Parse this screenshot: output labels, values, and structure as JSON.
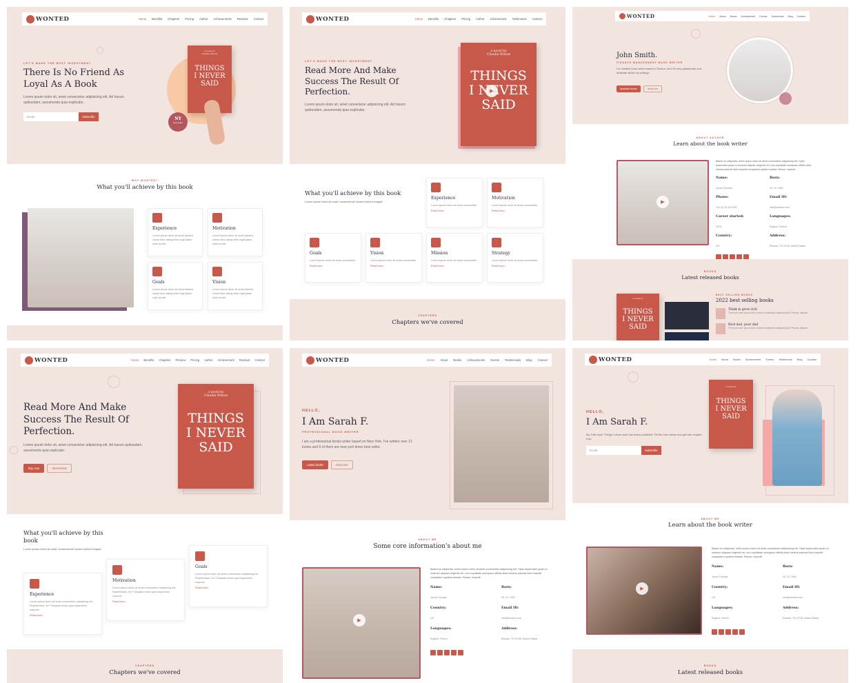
{
  "brand": "WONTED",
  "menus": {
    "m1": [
      "Home",
      "Benefits",
      "Chapters",
      "Pricing",
      "Author",
      "Achievements",
      "Reviews",
      "Contact"
    ],
    "m2": [
      "Home",
      "Benefits",
      "Chapters",
      "Pricing",
      "Author",
      "Achievement",
      "Testimonial",
      "Contact"
    ],
    "m3": [
      "Home",
      "About",
      "Books",
      "Achievement",
      "Events",
      "Testimonial",
      "Blog",
      "Contact"
    ],
    "m4": [
      "Home",
      "Benefits",
      "Chapters",
      "Preview",
      "Pricing",
      "Author",
      "Achievement",
      "Reviews",
      "Contact"
    ],
    "m5": [
      "Home",
      "About",
      "Books",
      "Achievements",
      "Events",
      "Testimonials",
      "Blog",
      "Contact"
    ],
    "m6": [
      "Home",
      "About",
      "Books",
      "Achievement",
      "Events",
      "Testimonial",
      "Blog",
      "Contact"
    ]
  },
  "p1": {
    "eyebrow": "LET'S MAKE THE BEST INVESTMENT",
    "title": "There Is No Friend As Loyal As A Book",
    "text": "Lorem ipsum dolor sit, amet consectetur adipisicing elit. Ad harum quibusdam, assumenda quia explicabo.",
    "email_ph": "Email",
    "subscribe": "Subscribe",
    "badge_top": "NY",
    "badge_bottom": "best seller",
    "sec_eyebrow": "WHY WONTED?",
    "sec_title": "What you'll achieve by this book",
    "cards": [
      "Experience",
      "Motivation",
      "Goals",
      "Vision"
    ],
    "card_text": "Lorem ipsum dolor sit amet ametus conse tetur ading elitor fugit platur iusto provid"
  },
  "book": {
    "by": "a novel by",
    "author": "Claudia Wilson",
    "line1": "THINGS",
    "line2": "I NEVER",
    "line3": "SAID"
  },
  "p2": {
    "eyebrow": "LET'S MAKE THE BEST INVESTMENT",
    "title": "Read More And Make Success The Result Of Perfection.",
    "text": "Lorem ipsum dolor sit, amet consectetur adipisicing elit. Ad harum quibusdam, assumenda quia explicabo.",
    "sec_title": "What you'll achieve by this book",
    "sec_text": "Lorem ipsum dolor sit amet, consectetuer laoreet dolore magna.",
    "cards": [
      "Experience",
      "Motivation",
      "Goals",
      "Vision",
      "Mission",
      "Strategy"
    ],
    "card_text": "Lorem ipsum dolor sit amet consectetur",
    "read_more": "Read more",
    "ch_eyebrow": "CHAPTERS",
    "ch_title": "Chapters we've covered"
  },
  "p3": {
    "name": "John Smith.",
    "role": "FINANCE MANAGEMENT BOOK WRITER",
    "text": "I'm creative book writer based in Boston, and I'm very passionate and dedicate about my writings.",
    "btn1": "Awarded books",
    "btn2": "About me",
    "about_eyebrow": "ABOUT AUTHOR",
    "about_title": "Learn about the book writer",
    "about_text": "Based on wikipedia, lorem ipsum dolor sit amet consectetur adipisicing elit. Optio aspernatur quam in nostrum aliquam eligendi vel, non cupiditate numquam officiis dicta minima placeat illum impedit voluptatum quidem beatae. Rerum, impedit.",
    "info": [
      {
        "k": "Name:",
        "v": "Jacob Thomas"
      },
      {
        "k": "Born:",
        "v": "25. 10. 1992"
      },
      {
        "k": "Phone:",
        "v": "+61 (0) 15 123 245"
      },
      {
        "k": "Email ID:",
        "v": "info@wonted.com"
      },
      {
        "k": "Career started:",
        "v": "2015"
      },
      {
        "k": "Languages:",
        "v": "English, French"
      },
      {
        "k": "Country:",
        "v": "US"
      },
      {
        "k": "Address:",
        "v": "Etowah, TN 37331 United States"
      }
    ],
    "books_eyebrow": "BOOKS",
    "books_title": "Latest released books",
    "best_eyebrow": "BEST SELLING BOOKS",
    "best_title": "2022 best selling books",
    "b1": "Think & grow rich",
    "b2": "Rich dad, poor dad",
    "b_text": "The book lorem ipsum dolor sit amet consectetur adipisicing elit. Pariatur, aliquam."
  },
  "p4": {
    "title": "Read More And Make Success The Result Of Perfection.",
    "text": "Lorem ipsum dolor sit, amet consectetur adipisicing elit. Ad harum quibusdam, assumenda quia explicabo.",
    "btn1": "Buy now",
    "btn2": "About Book",
    "sec_title": "What you'll achieve by this book",
    "sec_text": "Lorem ipsum dolor sit amet, consectetuer laoreet dolore magna.",
    "cards": [
      "Experience",
      "Motivation",
      "Goals"
    ],
    "card_text": "Lorem ipsum dolor sit amet consectetur adipisicing elit. Repellendus, ex? Voluptas minus quia asperiores corporis.",
    "read_more": "Read more",
    "ch_eyebrow": "CHAPTERS",
    "ch_title": "Chapters we've covered"
  },
  "p5": {
    "hello": "HELLO,",
    "name": "I Am Sarah F.",
    "role": "PROFESSIONAL BOOK WRITER",
    "text": "I am a professional books writer based on New York. I've written over 12 books and 6 of them are new york times best seller.",
    "btn1": "Latest books",
    "btn2": "About me",
    "core_eyebrow": "ABOUT ME",
    "core_title": "Some core information's about me",
    "about_text": "Based on wikipedia, lorem ipsum dolor sit amet consectetur adipisicing elit. Optio aspernatur quam in nostrum aliquam eligendi vel, non cupiditate numquam officiis dicta minima placeat illum impedit voluptatum quidem beatae. Rerum, impedit.",
    "info": [
      {
        "k": "Name:",
        "v": "Jacob Thomas"
      },
      {
        "k": "Born:",
        "v": "25. 10. 1992"
      },
      {
        "k": "Country:",
        "v": "US"
      },
      {
        "k": "Email ID:",
        "v": "info@wonted.com"
      },
      {
        "k": "Languages:",
        "v": "English, French"
      },
      {
        "k": "Address:",
        "v": "Etowah, TN 37331 United States"
      }
    ]
  },
  "p6": {
    "hello": "HELLO,",
    "name": "I Am Sarah F.",
    "text": "My 13th book 'Things I never said' has been published. Fill the form below and get free chapter now",
    "email_ph": "Email",
    "subscribe": "Subscribe",
    "about_eyebrow": "ABOUT ME",
    "about_title": "Learn about the book writer",
    "about_text": "Based on wikipedia, lorem ipsum dolor sit amet consectetur adipisicing elit. Optio aspernatur quam in nostrum aliquam eligendi vel, non cupiditate numquam officiis dicta minima placeat illum impedit voluptatum quidem beatae. Rerum, impedit.",
    "info": [
      {
        "k": "Name:",
        "v": "Jacob Thomas"
      },
      {
        "k": "Born:",
        "v": "25. 10. 1992"
      },
      {
        "k": "Country:",
        "v": "US"
      },
      {
        "k": "Email ID:",
        "v": "info@wonted.com"
      },
      {
        "k": "Languages:",
        "v": "English, French"
      },
      {
        "k": "Address:",
        "v": "Etowah, TN 37331 United States"
      }
    ],
    "books_eyebrow": "BOOKS",
    "books_title": "Latest released books"
  },
  "colors": {
    "accent": "#c8594a",
    "hero_bg": "#f2e4df",
    "text": "#2a2a3a"
  }
}
